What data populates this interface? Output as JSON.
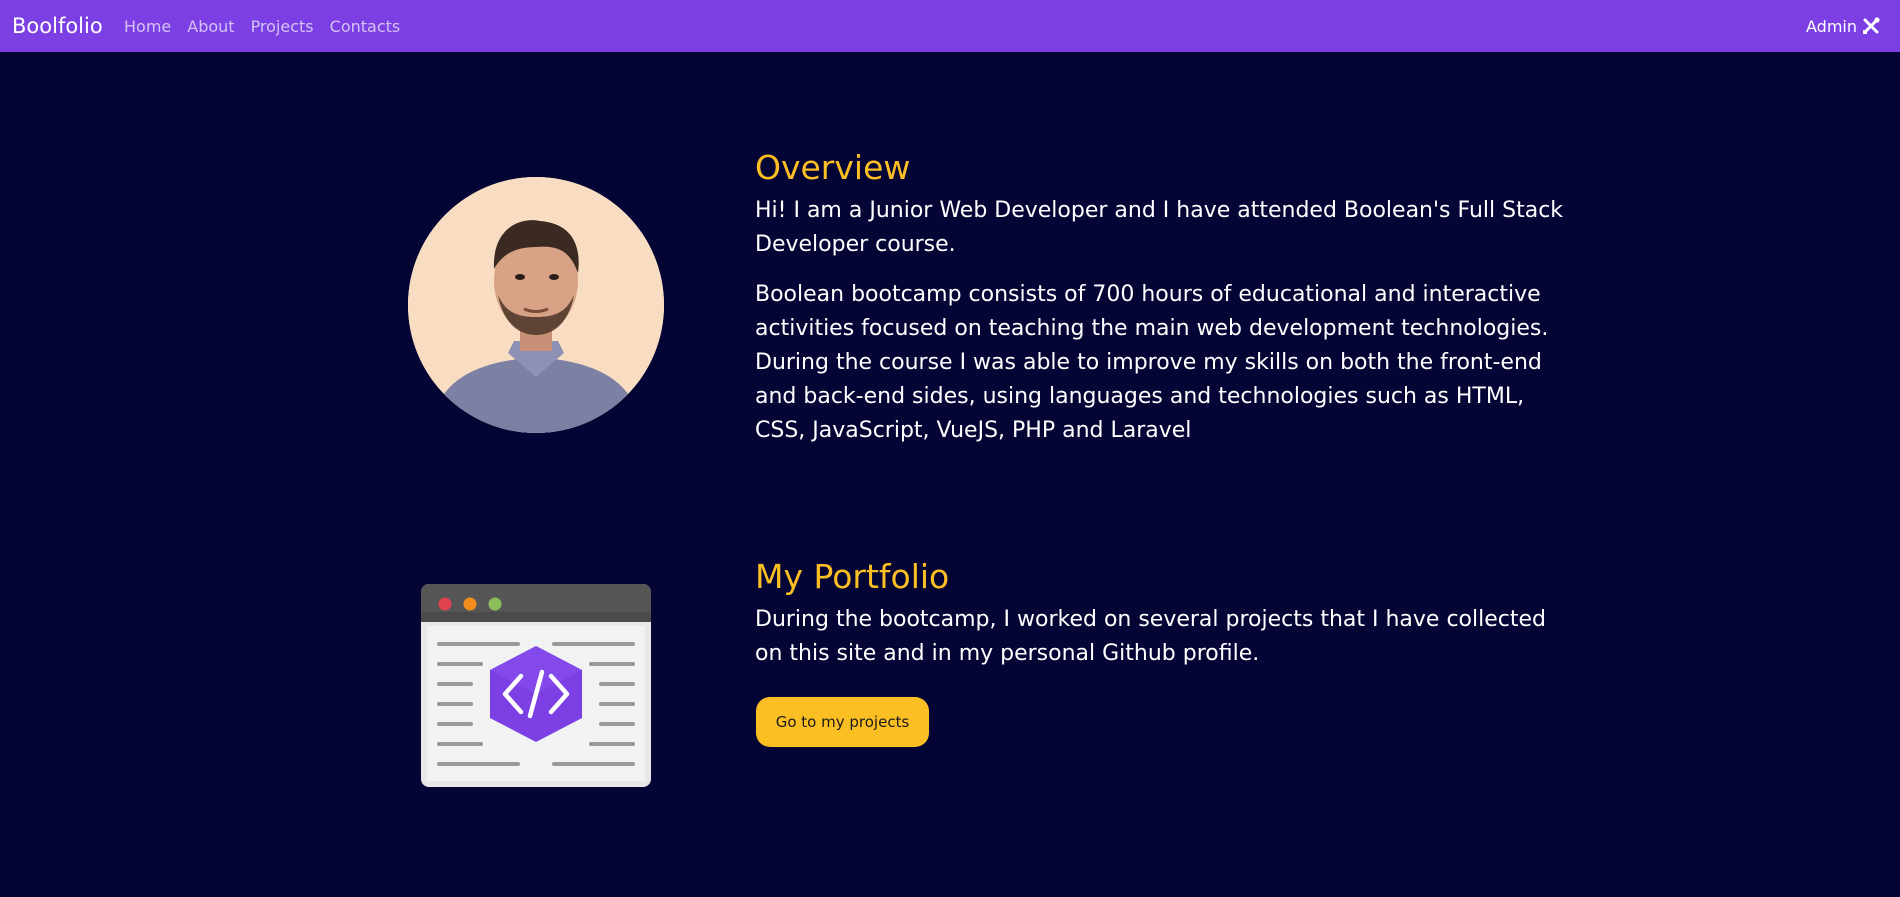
{
  "navbar": {
    "brand": "Boolfolio",
    "links": [
      "Home",
      "About",
      "Projects",
      "Contacts"
    ],
    "admin_label": "Admin",
    "admin_icon": "tools-icon",
    "background": "#7b3fe4"
  },
  "overview": {
    "title": "Overview",
    "intro": "Hi! I am a Junior Web Developer and I have attended Boolean's Full Stack Developer course.",
    "details": "Boolean bootcamp consists of 700 hours of educational and interactive activities focused on teaching the main web development technologies. During the course I was able to improve my skills on both the front-end and back-end sides, using languages and technologies such as HTML, CSS, JavaScript, VueJS, PHP and Laravel"
  },
  "portfolio": {
    "title": "My Portfolio",
    "text": "During the bootcamp, I worked on several projects that I have collected on this site and in my personal Github profile.",
    "button_label": "Go to my projects",
    "illustration_icon": "code-window-icon"
  },
  "colors": {
    "page_background": "#040535",
    "accent": "#fbbf24",
    "primary": "#7b3fe4"
  }
}
